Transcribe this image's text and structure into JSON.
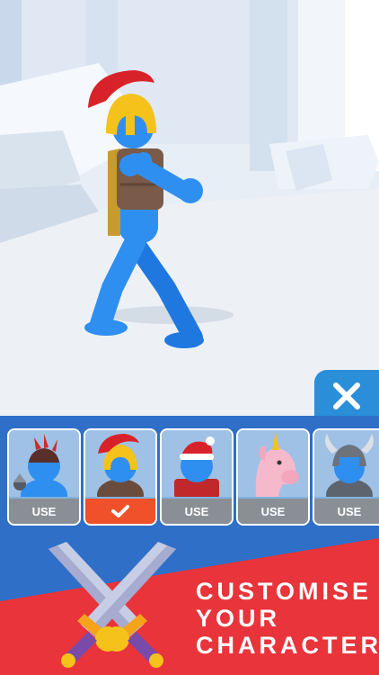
{
  "close_button": {
    "icon": "close-icon"
  },
  "skins": [
    {
      "name": "spiked-helmet",
      "button_label": "USE",
      "selected": false
    },
    {
      "name": "spartan-helmet",
      "button_label": "",
      "selected": true
    },
    {
      "name": "santa-hat",
      "button_label": "USE",
      "selected": false
    },
    {
      "name": "unicorn-head",
      "button_label": "USE",
      "selected": false
    },
    {
      "name": "viking-helmet",
      "button_label": "USE",
      "selected": false
    }
  ],
  "promo": {
    "line1": "CUSTOMISE",
    "line2": "YOUR",
    "line3": "CHARACTER"
  },
  "colors": {
    "accent": "#2f6fc7",
    "selected": "#f0502a",
    "banner": "#e8343a",
    "character": "#2f8ff0"
  }
}
